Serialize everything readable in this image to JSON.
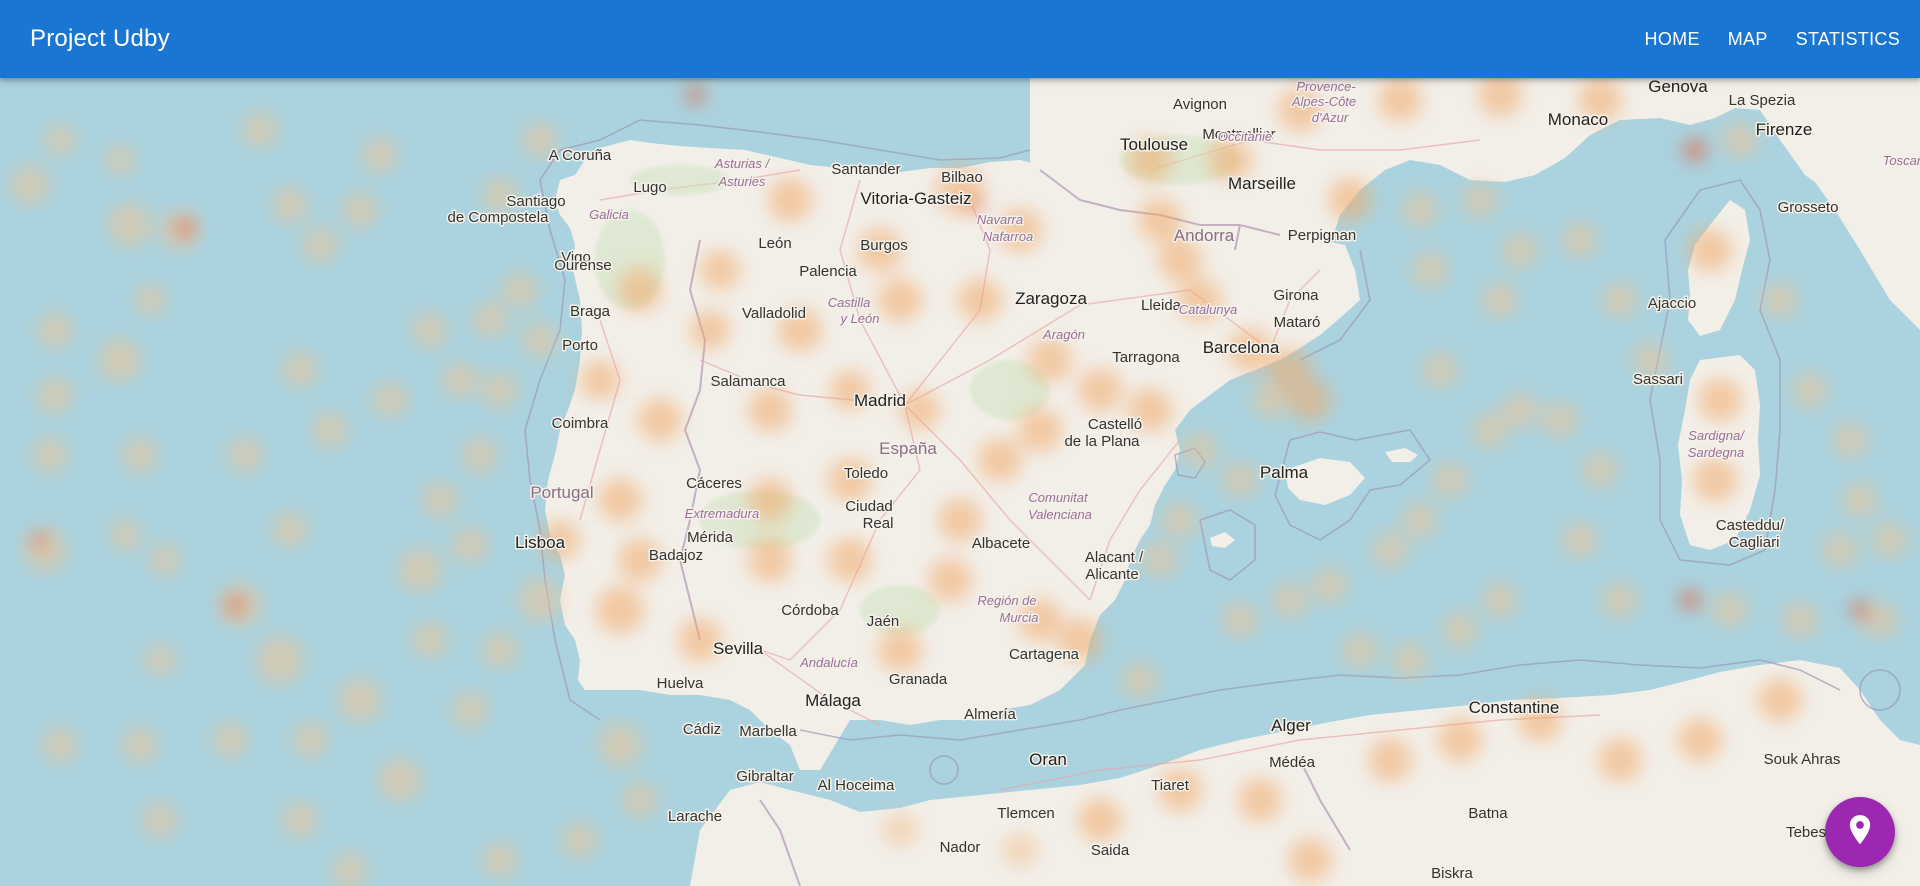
{
  "app": {
    "title": "Project Udby"
  },
  "nav": {
    "items": [
      "HOME",
      "MAP",
      "STATISTICS"
    ]
  },
  "colors": {
    "appbar": "#1976d2",
    "fab": "#9c27b0",
    "sea": "#aad3df",
    "land": "#f2efe9",
    "heat": "#f2a45c"
  },
  "fab": {
    "icon": "location-pin-icon"
  },
  "map": {
    "labels": [
      {
        "text": "A Coruña",
        "cls": "city"
      },
      {
        "text": "Lugo",
        "cls": "city"
      },
      {
        "text": "Santiago",
        "cls": "city"
      },
      {
        "text": "de Compostela",
        "cls": "city"
      },
      {
        "text": "Vigo",
        "cls": "city"
      },
      {
        "text": "Ourense",
        "cls": "city"
      },
      {
        "text": "Braga",
        "cls": "city"
      },
      {
        "text": "Porto",
        "cls": "city"
      },
      {
        "text": "Coimbra",
        "cls": "city"
      },
      {
        "text": "Lisboa",
        "cls": "big"
      },
      {
        "text": "Portugal",
        "cls": "country"
      },
      {
        "text": "Santander",
        "cls": "city"
      },
      {
        "text": "Bilbao",
        "cls": "city"
      },
      {
        "text": "Vitoria-Gasteiz",
        "cls": "big"
      },
      {
        "text": "León",
        "cls": "city"
      },
      {
        "text": "Burgos",
        "cls": "city"
      },
      {
        "text": "Palencia",
        "cls": "city"
      },
      {
        "text": "Valladolid",
        "cls": "city"
      },
      {
        "text": "Salamanca",
        "cls": "city"
      },
      {
        "text": "Madrid",
        "cls": "big"
      },
      {
        "text": "España",
        "cls": "country"
      },
      {
        "text": "Toledo",
        "cls": "city"
      },
      {
        "text": "Cáceres",
        "cls": "city"
      },
      {
        "text": "Mérida",
        "cls": "city"
      },
      {
        "text": "Badajoz",
        "cls": "city"
      },
      {
        "text": "Ciudad",
        "cls": "city"
      },
      {
        "text": "Real",
        "cls": "city"
      },
      {
        "text": "Córdoba",
        "cls": "city"
      },
      {
        "text": "Jaén",
        "cls": "city"
      },
      {
        "text": "Sevilla",
        "cls": "big"
      },
      {
        "text": "Huelva",
        "cls": "city"
      },
      {
        "text": "Cádiz",
        "cls": "city"
      },
      {
        "text": "Marbella",
        "cls": "city"
      },
      {
        "text": "Málaga",
        "cls": "big"
      },
      {
        "text": "Granada",
        "cls": "city"
      },
      {
        "text": "Almería",
        "cls": "city"
      },
      {
        "text": "Gibraltar",
        "cls": "city"
      },
      {
        "text": "Albacete",
        "cls": "city"
      },
      {
        "text": "Alacant /",
        "cls": "city"
      },
      {
        "text": "Alicante",
        "cls": "city"
      },
      {
        "text": "Cartagena",
        "cls": "city"
      },
      {
        "text": "Castelló",
        "cls": "city"
      },
      {
        "text": "de la Plana",
        "cls": "city"
      },
      {
        "text": "Zaragoza",
        "cls": "big"
      },
      {
        "text": "Lleida",
        "cls": "city"
      },
      {
        "text": "Tarragona",
        "cls": "city"
      },
      {
        "text": "Barcelona",
        "cls": "big"
      },
      {
        "text": "Girona",
        "cls": "city"
      },
      {
        "text": "Mataró",
        "cls": "city"
      },
      {
        "text": "Andorra",
        "cls": "country"
      },
      {
        "text": "Perpignan",
        "cls": "city"
      },
      {
        "text": "Toulouse",
        "cls": "big"
      },
      {
        "text": "Montpellier",
        "cls": "city"
      },
      {
        "text": "Avignon",
        "cls": "city"
      },
      {
        "text": "Marseille",
        "cls": "big"
      },
      {
        "text": "Monaco",
        "cls": "big"
      },
      {
        "text": "Genova",
        "cls": "big"
      },
      {
        "text": "La Spezia",
        "cls": "city"
      },
      {
        "text": "Firenze",
        "cls": "big"
      },
      {
        "text": "Grosseto",
        "cls": "city"
      },
      {
        "text": "Ajaccio",
        "cls": "city"
      },
      {
        "text": "Sassari",
        "cls": "city"
      },
      {
        "text": "Casteddu/",
        "cls": "city"
      },
      {
        "text": "Cagliari",
        "cls": "city"
      },
      {
        "text": "Palma",
        "cls": "big"
      },
      {
        "text": "Oran",
        "cls": "big"
      },
      {
        "text": "Alger",
        "cls": "big"
      },
      {
        "text": "Constantine",
        "cls": "big"
      },
      {
        "text": "Tlemcen",
        "cls": "city"
      },
      {
        "text": "Al Hoceima",
        "cls": "city"
      },
      {
        "text": "Larache",
        "cls": "city"
      },
      {
        "text": "Nador",
        "cls": "city"
      },
      {
        "text": "Tiaret",
        "cls": "city"
      },
      {
        "text": "Médéa",
        "cls": "city"
      },
      {
        "text": "Biskra",
        "cls": "city"
      },
      {
        "text": "Saida",
        "cls": "city"
      },
      {
        "text": "Souk Ahras",
        "cls": "city"
      },
      {
        "text": "Tebessa",
        "cls": "city"
      },
      {
        "text": "Batna",
        "cls": "city"
      },
      {
        "text": "Galicia",
        "cls": "region"
      },
      {
        "text": "Asturias /",
        "cls": "region"
      },
      {
        "text": "Asturies",
        "cls": "region"
      },
      {
        "text": "Castilla",
        "cls": "region"
      },
      {
        "text": "y León",
        "cls": "region"
      },
      {
        "text": "Navarra",
        "cls": "region"
      },
      {
        "text": "Nafarroa",
        "cls": "region"
      },
      {
        "text": "Aragón",
        "cls": "region"
      },
      {
        "text": "Catalunya",
        "cls": "region"
      },
      {
        "text": "Extremadura",
        "cls": "region"
      },
      {
        "text": "Comunitat",
        "cls": "region"
      },
      {
        "text": "Valenciana",
        "cls": "region"
      },
      {
        "text": "Región de",
        "cls": "region"
      },
      {
        "text": "Murcia",
        "cls": "region"
      },
      {
        "text": "Andalucía",
        "cls": "region"
      },
      {
        "text": "Occitanie",
        "cls": "region"
      },
      {
        "text": "Provence-",
        "cls": "region"
      },
      {
        "text": "Alpes-Côte",
        "cls": "region"
      },
      {
        "text": "d'Azur",
        "cls": "region"
      },
      {
        "text": "Toscana",
        "cls": "region"
      },
      {
        "text": "Sardigna/",
        "cls": "region"
      },
      {
        "text": "Sardegna",
        "cls": "region"
      }
    ]
  }
}
